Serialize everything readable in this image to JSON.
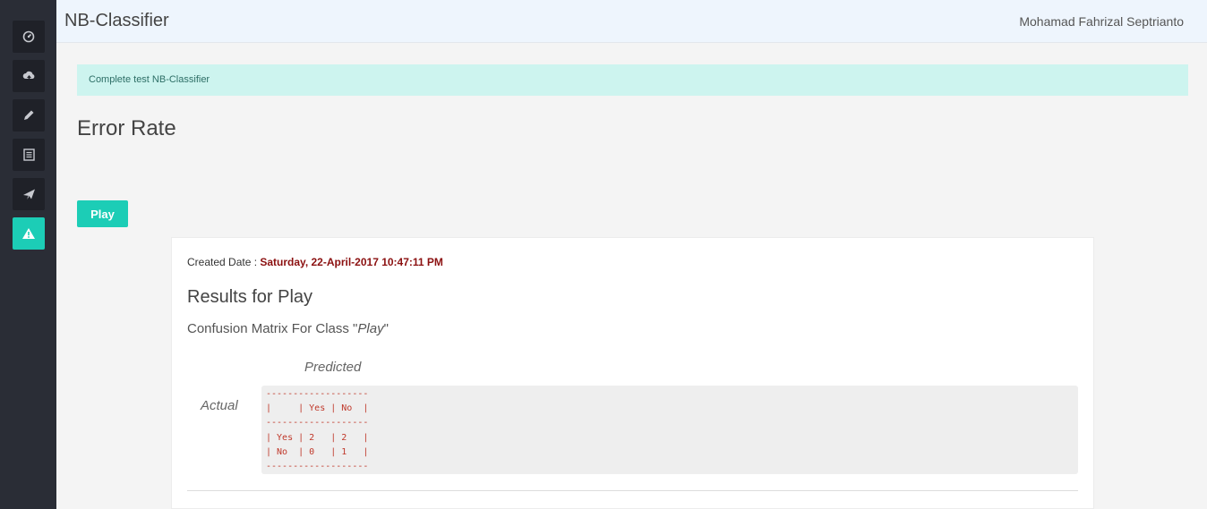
{
  "app": {
    "title": "NB-Classifier",
    "user": "Mohamad Fahrizal Septrianto"
  },
  "sidebar": {
    "items": [
      {
        "icon": "dashboard-icon",
        "active": false
      },
      {
        "icon": "cloud-upload-icon",
        "active": false
      },
      {
        "icon": "pencil-icon",
        "active": false
      },
      {
        "icon": "list-icon",
        "active": false
      },
      {
        "icon": "paper-plane-icon",
        "active": false
      },
      {
        "icon": "warning-icon",
        "active": true
      }
    ]
  },
  "alert": {
    "text": "Complete test NB-Classifier"
  },
  "page": {
    "heading": "Error Rate",
    "play_button": "Play"
  },
  "result": {
    "created_label": "Created Date : ",
    "created_value": "Saturday, 22-April-2017 10:47:11 PM",
    "title": "Results for Play",
    "matrix_caption_prefix": "Confusion Matrix For Class \"",
    "matrix_caption_class": "Play",
    "matrix_caption_suffix": "\"",
    "predicted_label": "Predicted",
    "actual_label": "Actual",
    "matrix_text": "-------------------\n|     | Yes | No  |\n-------------------\n| Yes | 2   | 2   |\n| No  | 0   | 1   |\n-------------------"
  },
  "colors": {
    "accent": "#1ccdb6",
    "sidebar_bg": "#2a2d36",
    "alert_bg": "#cdf4ef",
    "date_text": "#8b1010",
    "matrix_text": "#c0392b"
  }
}
